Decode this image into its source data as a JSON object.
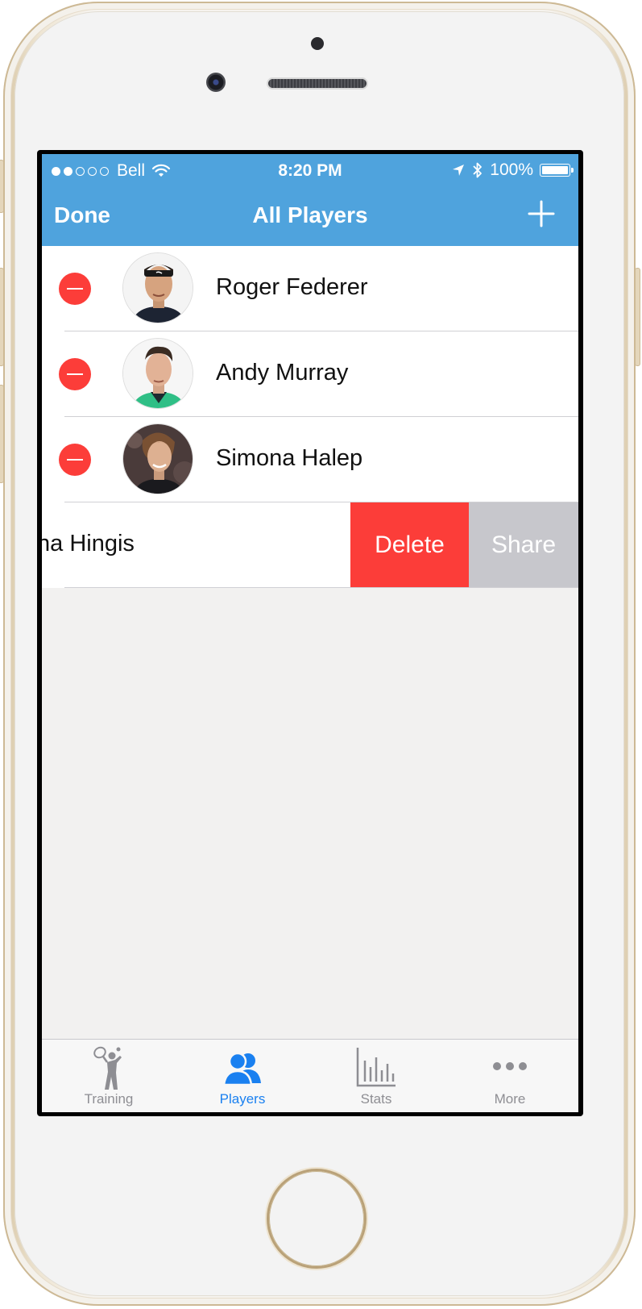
{
  "status_bar": {
    "carrier": "Bell",
    "time": "8:20 PM",
    "battery": "100%"
  },
  "nav": {
    "done_label": "Done",
    "title": "All Players"
  },
  "players": [
    {
      "name": "Roger Federer"
    },
    {
      "name": "Andy Murray"
    },
    {
      "name": "Simona Halep"
    },
    {
      "name": "na Hingis"
    }
  ],
  "swipe_actions": {
    "delete_label": "Delete",
    "share_label": "Share"
  },
  "tabs": [
    {
      "label": "Training",
      "icon": "tennis-player-icon"
    },
    {
      "label": "Players",
      "icon": "players-icon",
      "active": true
    },
    {
      "label": "Stats",
      "icon": "bar-chart-icon"
    },
    {
      "label": "More",
      "icon": "more-dots-icon"
    }
  ],
  "colors": {
    "accent": "#4fa3dd",
    "delete": "#fc3d39",
    "share": "#c7c7cc",
    "tab_active": "#1a80f0"
  }
}
